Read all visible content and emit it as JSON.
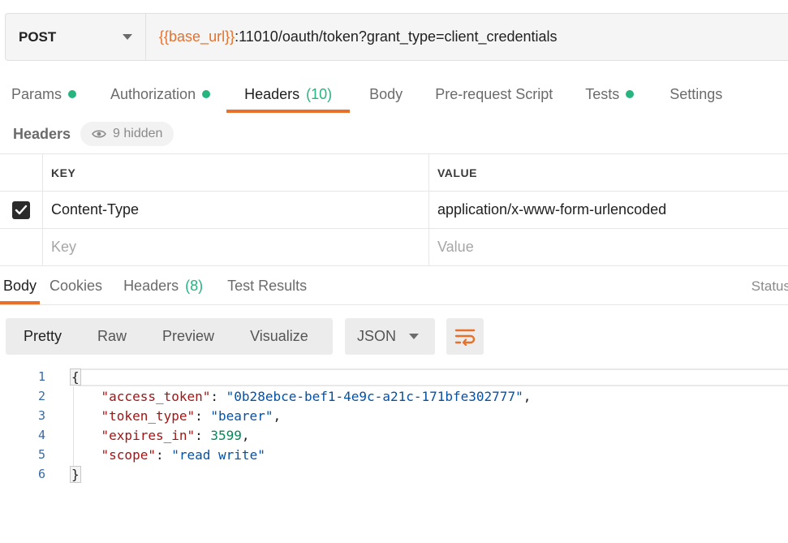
{
  "request": {
    "method": "POST",
    "url_var": "{{base_url}}",
    "url_rest": ":11010/oauth/token?grant_type=client_credentials"
  },
  "request_tabs": [
    {
      "label": "Params",
      "dot": true
    },
    {
      "label": "Authorization",
      "dot": true
    },
    {
      "label": "Headers",
      "count": "(10)",
      "active": true
    },
    {
      "label": "Body"
    },
    {
      "label": "Pre-request Script"
    },
    {
      "label": "Tests",
      "dot": true
    },
    {
      "label": "Settings"
    }
  ],
  "headers_section": {
    "title": "Headers",
    "hidden_label": "9 hidden"
  },
  "table": {
    "key_header": "KEY",
    "value_header": "VALUE",
    "rows": [
      {
        "key": "Content-Type",
        "value": "application/x-www-form-urlencoded",
        "checked": true
      }
    ],
    "key_placeholder": "Key",
    "value_placeholder": "Value"
  },
  "response_tabs": [
    {
      "label": "Body",
      "active": true
    },
    {
      "label": "Cookies"
    },
    {
      "label": "Headers",
      "count": "(8)"
    },
    {
      "label": "Test Results"
    }
  ],
  "status_label": "Status",
  "view": {
    "buttons": [
      "Pretty",
      "Raw",
      "Preview",
      "Visualize"
    ],
    "format": "JSON"
  },
  "code_lines": [
    {
      "num": "1",
      "open": "{"
    },
    {
      "num": "2",
      "key": "\"access_token\"",
      "value": "\"0b28ebce-bef1-4e9c-a21c-171bfe302777\"",
      "type": "s",
      "comma": ","
    },
    {
      "num": "3",
      "key": "\"token_type\"",
      "value": "\"bearer\"",
      "type": "s",
      "comma": ","
    },
    {
      "num": "4",
      "key": "\"expires_in\"",
      "value": "3599",
      "type": "n",
      "comma": ","
    },
    {
      "num": "5",
      "key": "\"scope\"",
      "value": "\"read write\"",
      "type": "s",
      "comma": ""
    },
    {
      "num": "6",
      "close": "}"
    }
  ],
  "colors": {
    "accent": "#e8702a",
    "dot_green": "#26b47f",
    "json_key": "#a31515",
    "json_string": "#0451a5",
    "json_number": "#098658"
  }
}
